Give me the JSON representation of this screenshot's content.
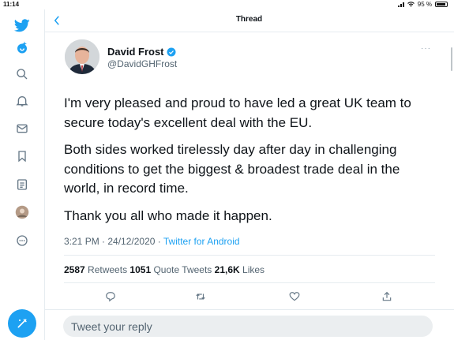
{
  "status_bar": {
    "time": "11:14",
    "battery": "95 %"
  },
  "header": {
    "title": "Thread"
  },
  "sidebar": {
    "items": [
      "twitter-logo",
      "explore-icon",
      "search-icon",
      "notifications-icon",
      "messages-icon",
      "bookmarks-icon",
      "lists-icon",
      "profile-avatar",
      "more-icon"
    ]
  },
  "tweet": {
    "author_name": "David Frost",
    "author_handle": "@DavidGHFrost",
    "paragraphs": [
      "I'm very pleased and proud to have led a great UK team to secure today's excellent deal with the EU.",
      "Both sides worked tirelessly day after day in challenging conditions to get the biggest & broadest trade deal in the world, in record time.",
      "Thank you all who made it happen."
    ],
    "timestamp": "3:21 PM · 24/12/2020 · ",
    "source": "Twitter for Android",
    "stats": {
      "retweets_count": "2587",
      "retweets_label": "Retweets",
      "quotes_count": "1051",
      "quotes_label": "Quote Tweets",
      "likes_count": "21,6K",
      "likes_label": "Likes"
    }
  },
  "reply": {
    "placeholder": "Tweet your reply"
  },
  "colors": {
    "accent": "#1da1f2",
    "text": "#0f1419",
    "muted": "#536471",
    "border": "#e6ecf0"
  }
}
